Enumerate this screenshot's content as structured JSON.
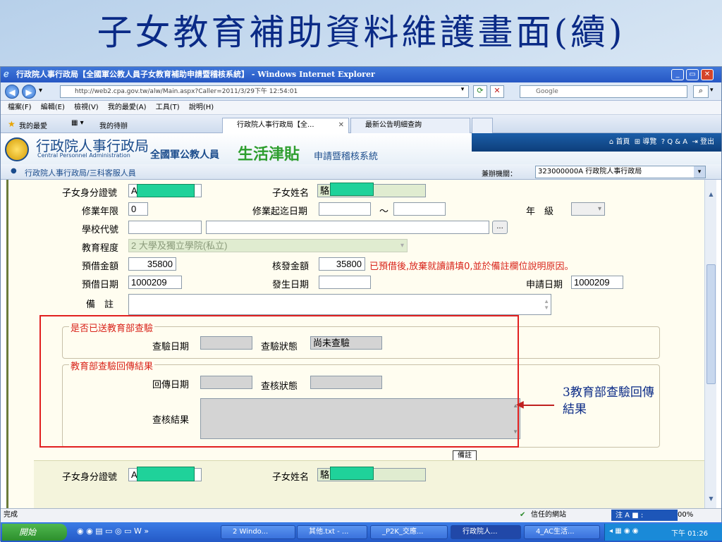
{
  "slide": {
    "title": "子女教育補助資料維護畫面(續)"
  },
  "window": {
    "title": "行政院人事行政局【全國軍公教人員子女教育補助申請暨稽核系統】 - Windows Internet Explorer"
  },
  "address": {
    "url": "http://web2.cpa.gov.tw/alw/Main.aspx?Caller=2011/3/29下午 12:54:01",
    "search_placeholder": "Google"
  },
  "menu": [
    "檔案(F)",
    "編輯(E)",
    "檢視(V)",
    "我的最愛(A)",
    "工具(T)",
    "說明(H)"
  ],
  "favbar": {
    "favorites": "我的最愛",
    "todo": "我的待辦"
  },
  "tabs": [
    "行政院人事行政局【全...",
    "最新公告明細查詢"
  ],
  "site": {
    "org_name": "行政院人事行政局",
    "org_en": "Central Personnel Administration",
    "system_prefix": "全國軍公教人員",
    "system_main": "生活津貼",
    "system_suffix": "申請暨稽核系統",
    "nav": [
      "首頁",
      "導覽",
      "Q & A",
      "登出"
    ],
    "breadcrumb": "行政院人事行政局/三科客服人員",
    "agency_label": "兼辦機關：",
    "agency_value": "323000000A 行政院人事行政局"
  },
  "form": {
    "child_id_label": "子女身分證號",
    "child_id_prefix": "A",
    "child_name_label": "子女姓名",
    "child_name_prefix": "駱",
    "study_years_label": "修業年限",
    "study_years_value": "0",
    "study_period_label": "修業起迄日期",
    "period_sep": "～",
    "grade_label": "年　級",
    "school_code_label": "學校代號",
    "school_btn": "...",
    "edu_level_label": "教育程度",
    "edu_level_value": "2 大學及獨立學院(私立)",
    "advance_amount_label": "預借金額",
    "advance_amount_value": "35800",
    "approved_amount_label": "核發金額",
    "approved_amount_value": "35800",
    "warning_text": "已預借後,放棄就讀請填0,並於備註欄位說明原因。",
    "advance_date_label": "預借日期",
    "advance_date_value": "1000209",
    "occur_date_label": "發生日期",
    "apply_date_label": "申請日期",
    "apply_date_value": "1000209",
    "remark_label": "備　註",
    "moe_section_title": "是否已送教育部查驗",
    "check_date_label": "查驗日期",
    "check_status_label": "查驗狀態",
    "check_status_value": "尚未查驗",
    "moe_result_title": "教育部查驗回傳結果",
    "return_date_label": "回傳日期",
    "audit_status_label": "查核狀態",
    "audit_result_label": "查核結果",
    "remark_tag": "備註"
  },
  "annotation": {
    "text_line1": "3教育部查驗回傳",
    "text_line2": "結果"
  },
  "status": {
    "left": "完成",
    "zone": "信任的網站",
    "zoom": "00%"
  },
  "taskbar": {
    "start": "開始",
    "items": [
      "2 Windo...",
      "其他.txt - ...",
      "_P2K_交應...",
      "行政院人...",
      "4_AC生活..."
    ],
    "clock": "下午 01:26"
  },
  "colors": {
    "accent_red": "#d9241b",
    "mask_green": "#1fd29a",
    "title_blue": "#0a2a86"
  }
}
